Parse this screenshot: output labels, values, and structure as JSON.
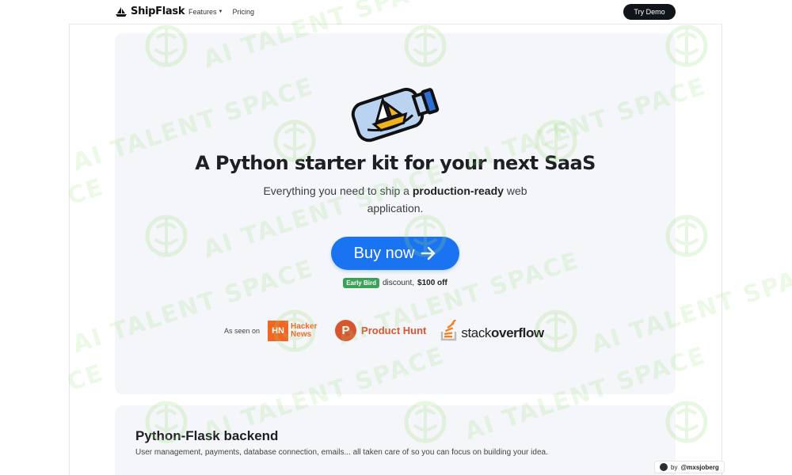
{
  "navbar": {
    "brand": "ShipFlask",
    "links": [
      {
        "label": "Features",
        "has_dropdown": true
      },
      {
        "label": "Pricing",
        "has_dropdown": false
      }
    ],
    "cta_label": "Try Demo"
  },
  "hero": {
    "illustration": "ship-in-bottle-icon",
    "title": "A Python starter kit for your next SaaS",
    "subtitle_prefix": "Everything you need to ship a ",
    "subtitle_bold": "production-ready",
    "subtitle_suffix": " web application.",
    "buy_label": "Buy now",
    "promo_badge": "Early Bird",
    "promo_text": "discount,",
    "promo_amount": "$100 off",
    "as_seen_label": "As seen on",
    "hn_box": "HN",
    "hn_text_1": "Hacker",
    "hn_text_2": "News",
    "ph_letter": "P",
    "ph_text": "Product Hunt",
    "so_text_1": "stack",
    "so_text_2": "overflow"
  },
  "backend": {
    "title_bold": "Python-Flask",
    "title_rest": " backend",
    "description": "User management, payments, database connection, emails... all taken care of so you can focus on building your idea."
  },
  "byline": {
    "prefix": "by",
    "handle": "@mxsjoberg"
  },
  "watermark_text": "AI TALENT SPACE",
  "watermark_fragment": "CE",
  "colors": {
    "primary_blue": "#1a73f0",
    "early_bird_green": "#3aa357",
    "hacker_news_orange": "#f26522",
    "product_hunt_orange": "#da552f",
    "dark_button": "#111418"
  }
}
